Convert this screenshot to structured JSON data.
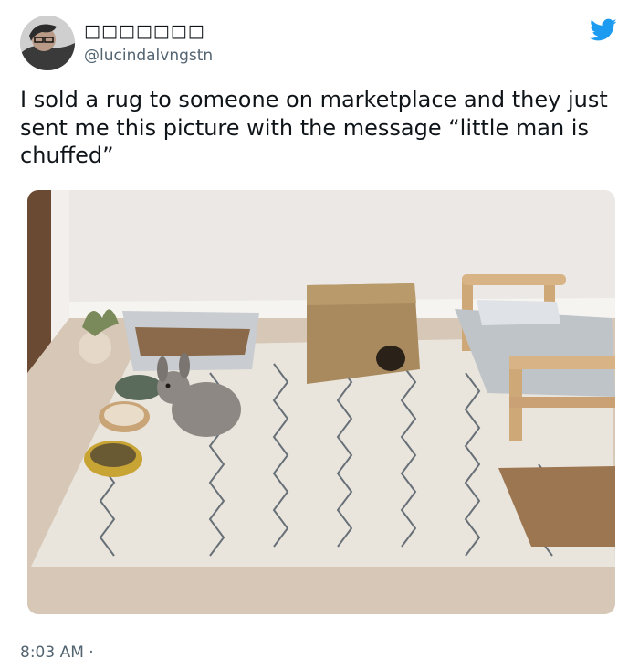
{
  "tweet": {
    "display_name": "□□□□□□□",
    "handle": "@lucindalvngstn",
    "text": "I sold a rug to someone on marketplace and they just sent me this picture with the message “little man is chuffed”",
    "time": "8:03 AM ·",
    "avatar_icon": "avatar-photo",
    "brand_icon": "twitter-bird-icon",
    "brand_color": "#1d9bf0"
  }
}
